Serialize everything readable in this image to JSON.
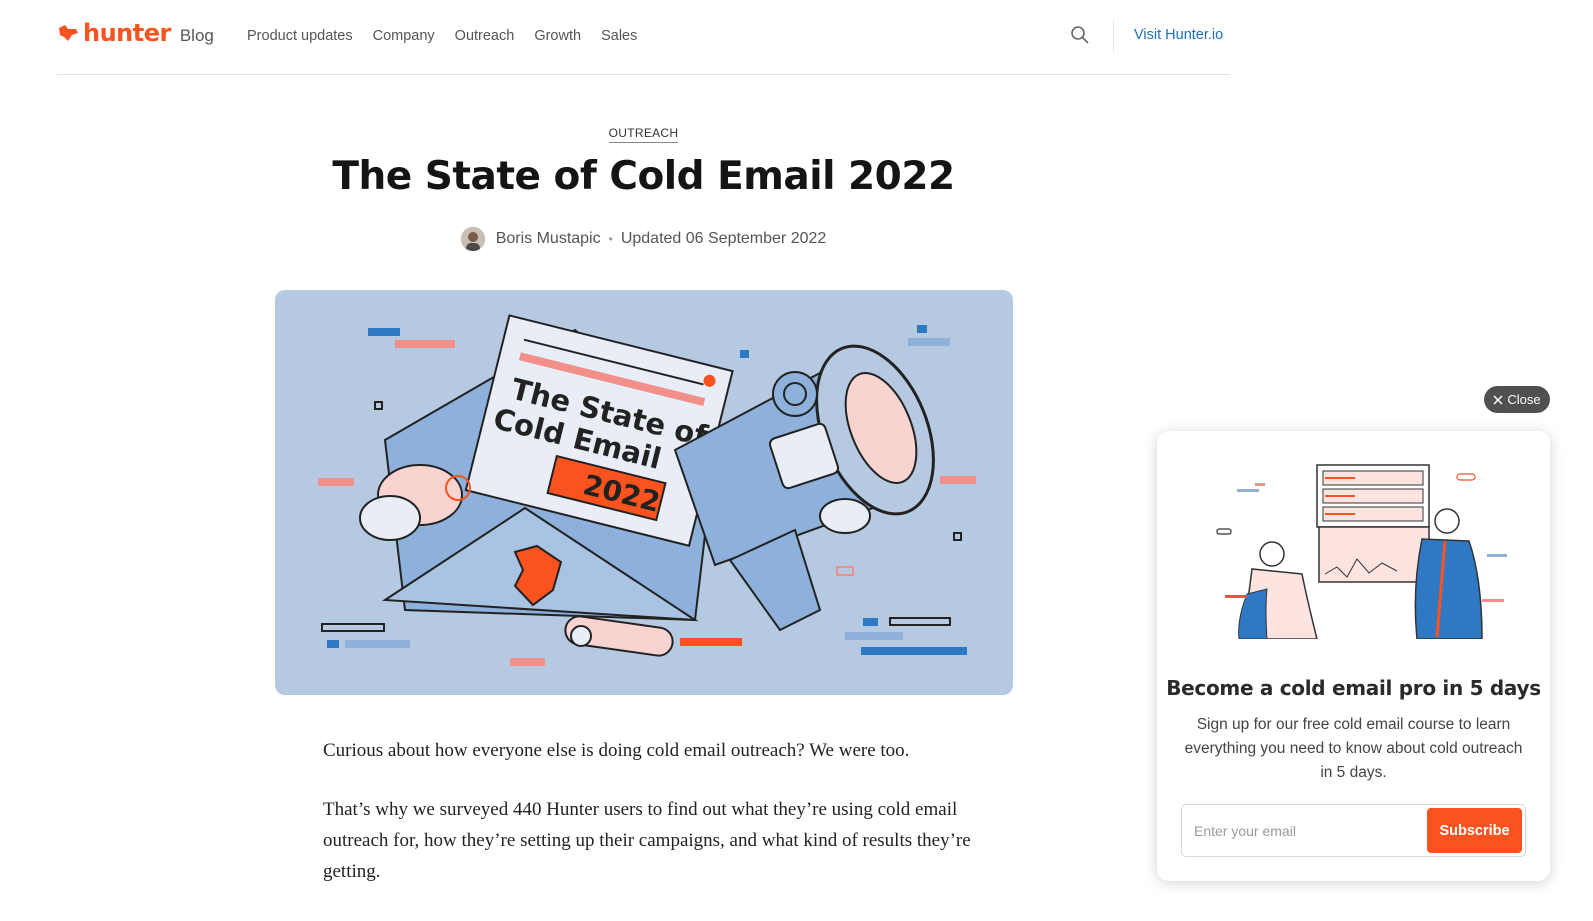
{
  "header": {
    "logo_text": "hunter",
    "blog_label": "Blog",
    "nav": [
      {
        "label": "Product updates"
      },
      {
        "label": "Company"
      },
      {
        "label": "Outreach"
      },
      {
        "label": "Growth"
      },
      {
        "label": "Sales"
      }
    ],
    "visit_label": "Visit Hunter.io",
    "search_icon": "search-icon"
  },
  "article": {
    "category": "OUTREACH",
    "title": "The State of Cold Email 2022",
    "author": "Boris Mustapic",
    "separator": "•",
    "updated": "Updated 06 September 2022",
    "hero": {
      "line1": "The State of",
      "line2": "Cold Email",
      "year": "2022"
    },
    "paragraphs": [
      "Curious about how everyone else is doing cold email outreach? We were too.",
      "That’s why we surveyed 440 Hunter users to find out what they’re using cold email outreach for, how they’re setting up their campaigns, and what kind of results they’re getting."
    ]
  },
  "popup": {
    "close_label": "Close",
    "title": "Become a cold email pro in 5 days",
    "description": "Sign up for our free cold email course to learn everything you need to know about cold outreach in 5 days.",
    "email_placeholder": "Enter your email",
    "subscribe_label": "Subscribe"
  },
  "colors": {
    "brand": "#fa5320",
    "link": "#1a6fc4",
    "hero_bg": "#b5c9e1"
  }
}
